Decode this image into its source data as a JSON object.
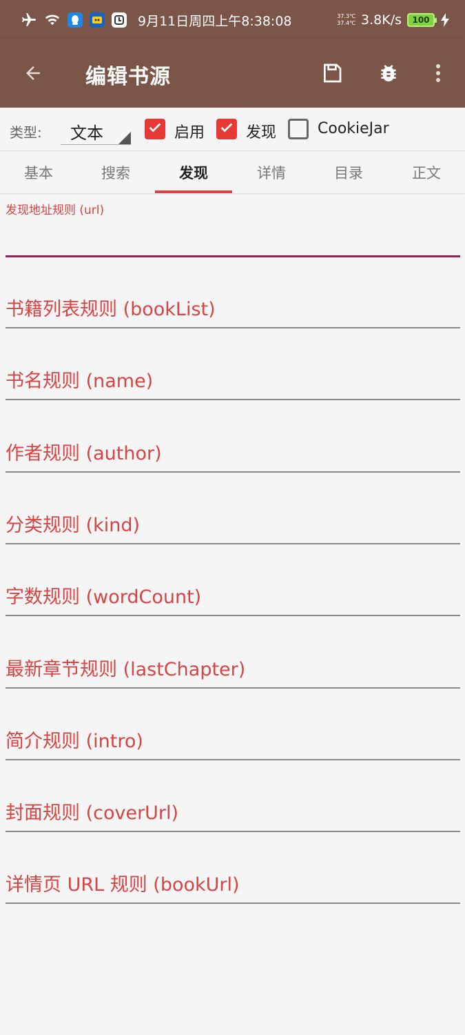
{
  "status_bar": {
    "time": "9月11日周四上午8:38:08",
    "temp_top": "37.3℃",
    "temp_bottom": "37.4℃",
    "net_speed": "3.8K/s",
    "battery": "100",
    "icons": [
      "airplane-icon",
      "wifi-icon",
      "qq-icon",
      "app-icon",
      "sync-icon",
      "charging-icon"
    ]
  },
  "toolbar": {
    "title": "编辑书源",
    "icons": [
      "back-arrow-icon",
      "save-icon",
      "debug-bug-icon",
      "more-vert-icon"
    ]
  },
  "options": {
    "type_label": "类型:",
    "type_value": "文本",
    "enable_label": "启用",
    "enable_checked": true,
    "discover_label": "发现",
    "discover_checked": true,
    "cookiejar_label": "CookieJar",
    "cookiejar_checked": false
  },
  "tabs": [
    {
      "label": "基本"
    },
    {
      "label": "搜索"
    },
    {
      "label": "发现"
    },
    {
      "label": "详情"
    },
    {
      "label": "目录"
    },
    {
      "label": "正文"
    }
  ],
  "active_tab": "发现",
  "form": {
    "focused_field_label": "发现地址规则 (url)",
    "focused_field_value": "",
    "fields": [
      {
        "hint": "书籍列表规则 (bookList)"
      },
      {
        "hint": "书名规则 (name)"
      },
      {
        "hint": "作者规则 (author)"
      },
      {
        "hint": "分类规则 (kind)"
      },
      {
        "hint": "字数规则 (wordCount)"
      },
      {
        "hint": "最新章节规则 (lastChapter)"
      },
      {
        "hint": "简介规则 (intro)"
      },
      {
        "hint": "封面规则 (coverUrl)"
      },
      {
        "hint": "详情页 URL 规则 (bookUrl)"
      }
    ]
  },
  "colors": {
    "toolbar": "#7a5548",
    "accent": "#d84343",
    "focus_line": "#9c1c55",
    "background": "#f5f5f5"
  }
}
